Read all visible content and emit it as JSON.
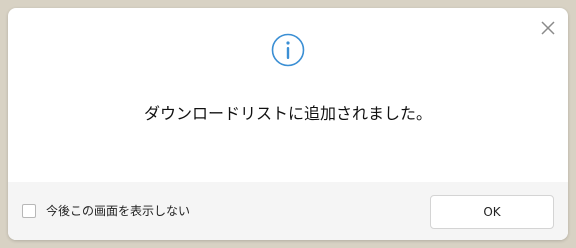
{
  "dialog": {
    "message": "ダウンロードリストに追加されました。",
    "checkbox_label": "今後この画面を表示しない",
    "checkbox_checked": false,
    "ok_label": "OK",
    "info_icon": "info-icon",
    "close_icon": "close-icon",
    "info_color": "#3b8fd4"
  }
}
